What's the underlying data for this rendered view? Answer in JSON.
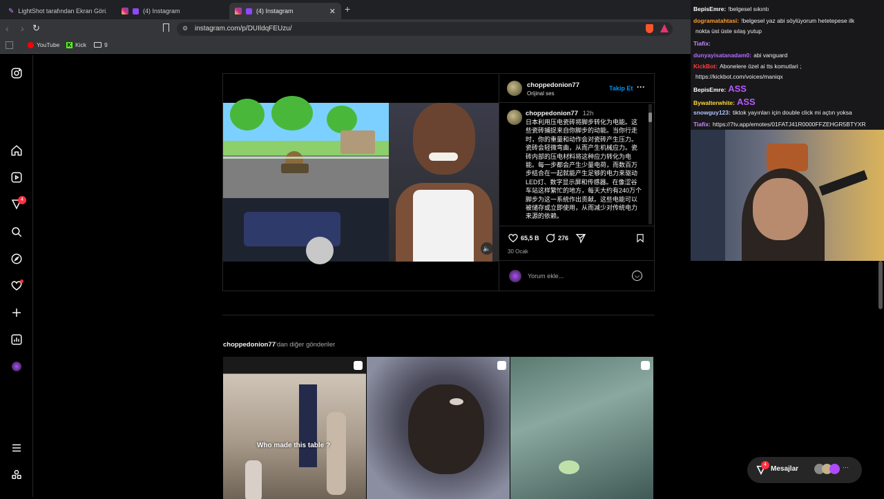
{
  "browser": {
    "tabs": [
      {
        "label": "LightShot tarafından Ekran Görüntüsü"
      },
      {
        "label": "(4) Instagram"
      },
      {
        "label": "(4) Instagram"
      }
    ],
    "new_tab": "+",
    "url": "instagram.com/p/DUIldqFEUzu/",
    "bookmarks": [
      {
        "label": "YouTube"
      },
      {
        "label": "Kick"
      },
      {
        "label": "9"
      }
    ]
  },
  "sidenav": {
    "notifications_badge": "4"
  },
  "post": {
    "author": "choppedonion77",
    "audio": "Orijinal ses",
    "follow": "Takip Et",
    "caption_user": "choppedonion77",
    "caption_time": "12h",
    "caption_text": "日本利用压电瓷砖将脚步转化为电能。这些瓷砖捕捉来自你脚步的动能。当你行走时，你的重量和动作会对瓷砖产生压力。瓷砖会轻微弯曲，从而产生机械应力。瓷砖内部的压电材料将这种应力转化为电能。每一步都会产生少量电荷，而数百万步结合在一起就能产生足够的电力来驱动LED灯、数字显示屏和传感器。在像涩谷车站这样繁忙的地方，每天大约有240万个脚步为这一系统作出贡献。这些电能可以被储存或立即使用，从而减少对传统电力来源的依赖。",
    "likes": "65,5 B",
    "comments": "276",
    "date": "30 Ocak",
    "comment_placeholder": "Yorum ekle..."
  },
  "more": {
    "heading_user": "choppedonion77",
    "heading_suffix": "'dan diğer gönderiler",
    "thumb1_overlay": "Who made this table ?"
  },
  "messages": {
    "label": "Mesajlar",
    "badge": "4"
  },
  "chat": {
    "lines": [
      {
        "user": "BepisEmre:",
        "text": "!belgesel sıkıntı",
        "color": "#ffffff"
      },
      {
        "user": "dogramatahtasi:",
        "text": "!belgesel yaz abi söylüyorum hetetepese ilk",
        "color": "#ff9d2f"
      },
      {
        "user": "",
        "text": "nokta üst üste sılaş yutup",
        "color": "#ffffff"
      },
      {
        "user": "Tiafix:",
        "text": "",
        "color": "#c98bff"
      },
      {
        "user": "dunyayisatanadam0:",
        "text": "abi vanguard",
        "color": "#b36bff"
      },
      {
        "user": "KickBot:",
        "text": "Abonelere özel ai tts komutlari ;",
        "color": "#ff3c3c"
      },
      {
        "user": "",
        "text": "https://kickbot.com/voices/maniqx",
        "color": "#ffffff"
      },
      {
        "user": "BepisEmre:",
        "text": "ASS",
        "color": "#ffffff"
      },
      {
        "user": "Bywalterwhite:",
        "text": "ASS",
        "color": "#ffd93a"
      },
      {
        "user": "snowguy123:",
        "text": "tiktok yayınları için double click mi açtın yoksa",
        "color": "#b0c4ff"
      },
      {
        "user": "Tiafix:",
        "text": "https://7tv.app/emotes/01FATJ41R0000FFZEHGR5BTYXR",
        "color": "#c98bff"
      }
    ]
  },
  "colors": {
    "accent_blue": "#0095f6",
    "badge_red": "#ff3040",
    "background": "#000000"
  }
}
